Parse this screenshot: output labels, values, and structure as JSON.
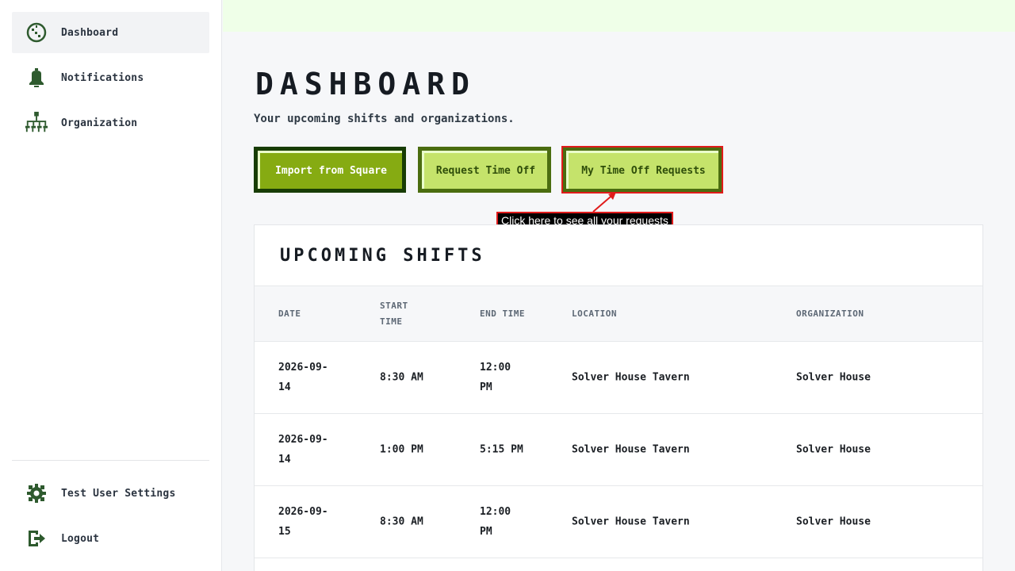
{
  "sidebar": {
    "items": [
      {
        "label": "Dashboard",
        "icon": "dashboard-icon"
      },
      {
        "label": "Notifications",
        "icon": "bell-icon"
      },
      {
        "label": "Organization",
        "icon": "org-chart-icon"
      }
    ],
    "bottom_items": [
      {
        "label": "Test User Settings",
        "icon": "gear-icon"
      },
      {
        "label": "Logout",
        "icon": "logout-icon"
      }
    ]
  },
  "header": {
    "title": "DASHBOARD",
    "subtitle": "Your upcoming shifts and organizations."
  },
  "actions": {
    "import_label": "Import from Square",
    "request_label": "Request Time Off",
    "my_requests_label": "My Time Off Requests"
  },
  "annotation": {
    "text": "Click here to see all your requests"
  },
  "shifts": {
    "title": "UPCOMING SHIFTS",
    "columns": [
      "DATE",
      "START TIME",
      "END TIME",
      "LOCATION",
      "ORGANIZATION"
    ],
    "rows": [
      [
        "2026-09-14",
        "8:30 AM",
        "12:00 PM",
        "Solver House Tavern",
        "Solver House"
      ],
      [
        "2026-09-14",
        "1:00 PM",
        "5:15 PM",
        "Solver House Tavern",
        "Solver House"
      ],
      [
        "2026-09-15",
        "8:30 AM",
        "12:00 PM",
        "Solver House Tavern",
        "Solver House"
      ]
    ]
  },
  "colors": {
    "accent": "#86ab12",
    "accent_dark": "#183d05",
    "button_light": "#c5e36b",
    "highlight": "#e01b1b",
    "icon_green": "#2e5a2e"
  }
}
